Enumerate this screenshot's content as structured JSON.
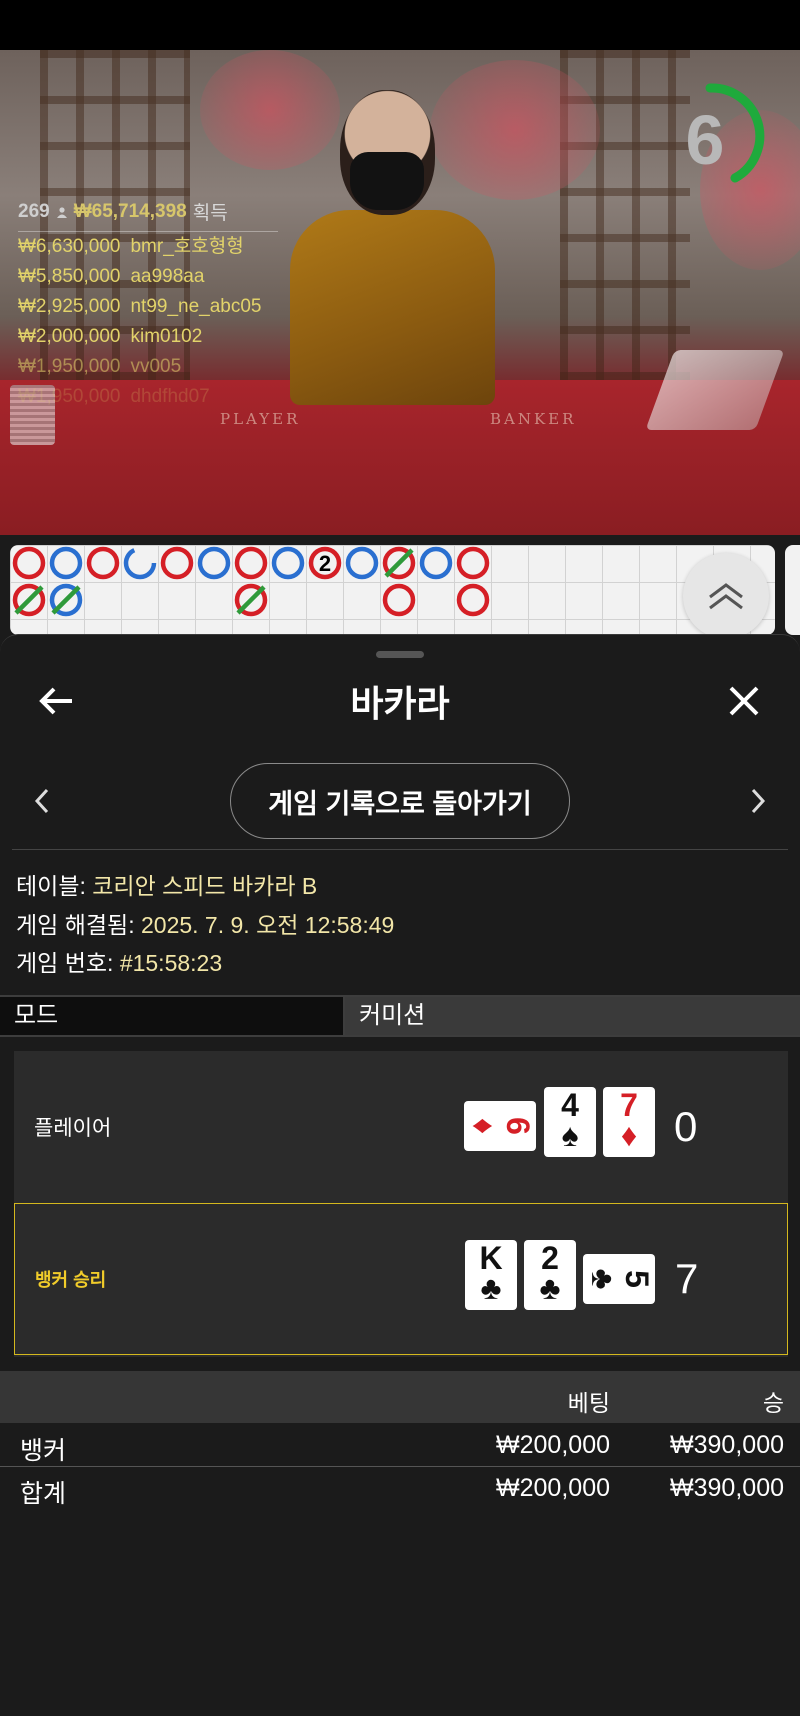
{
  "video": {
    "timer_value": "6",
    "felt_player": "PLAYER",
    "felt_banker": "BANKER"
  },
  "winners": {
    "count": "269",
    "total": "₩65,714,398",
    "total_suffix": "획득",
    "rows": [
      {
        "amount": "₩6,630,000",
        "user": "bmr_호호형형"
      },
      {
        "amount": "₩5,850,000",
        "user": "aa998aa"
      },
      {
        "amount": "₩2,925,000",
        "user": "nt99_ne_abc05"
      },
      {
        "amount": "₩2,000,000",
        "user": "kim0102"
      },
      {
        "amount": "₩1,950,000",
        "user": "vv005"
      },
      {
        "amount": "₩1,950,000",
        "user": "dhdfhd07"
      }
    ]
  },
  "road": {
    "top_row": [
      "P",
      "B",
      "P",
      "B-half",
      "P",
      "B",
      "P",
      "B",
      "P2",
      "B",
      "P-tie",
      "B",
      "P"
    ],
    "bottom_row": [
      "P-tie",
      "B-tie",
      "",
      "",
      "",
      "",
      "P-tie",
      "",
      "",
      "",
      "P",
      "",
      "P"
    ]
  },
  "sheet": {
    "title": "바카라",
    "history_button": "게임 기록으로 돌아가기",
    "table_label": "테이블:",
    "table_value": "코리안 스피드 바카라 B",
    "resolved_label": "게임 해결됨:",
    "resolved_value": "2025. 7. 9. 오전 12:58:49",
    "number_label": "게임 번호:",
    "number_value": "#15:58:23",
    "mode_label": "모드",
    "commission_label": "커미션"
  },
  "hands": {
    "player": {
      "label": "플레이어",
      "score": "0",
      "cards": [
        {
          "rank": "6",
          "suit": "♦",
          "red": true,
          "orient": "h"
        },
        {
          "rank": "4",
          "suit": "♠",
          "red": false,
          "orient": "v"
        },
        {
          "rank": "7",
          "suit": "♦",
          "red": true,
          "orient": "v"
        }
      ]
    },
    "banker": {
      "label": "뱅커 승리",
      "score": "7",
      "cards": [
        {
          "rank": "K",
          "suit": "♣",
          "red": false,
          "orient": "v"
        },
        {
          "rank": "2",
          "suit": "♣",
          "red": false,
          "orient": "v"
        },
        {
          "rank": "5",
          "suit": "♣",
          "red": false,
          "orient": "h"
        }
      ]
    }
  },
  "bets": {
    "col_bet": "베팅",
    "col_win": "승",
    "rows": [
      {
        "name": "뱅커",
        "bet": "₩200,000",
        "win": "₩390,000"
      },
      {
        "name": "합계",
        "bet": "₩200,000",
        "win": "₩390,000"
      }
    ]
  },
  "colors": {
    "player_red": "#d51f26",
    "banker_blue": "#2a6fd0",
    "tie_green": "#2f9a3a",
    "timer_green": "#1faa3c",
    "winner_gold": "#f1cc2a"
  }
}
